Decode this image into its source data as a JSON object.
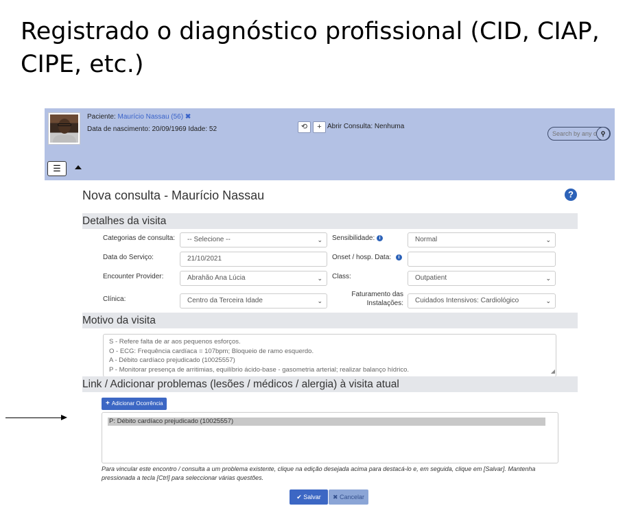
{
  "slide": {
    "title": "Registrado o diagnóstico profissional (CID, CIAP, CIPE, etc.)"
  },
  "patient_bar": {
    "patient_label": "Paciente:",
    "patient_name": "Maurício Nassau (56)",
    "close_glyph": "✖",
    "birth_info": "Data de nascimento: 20/09/1969 Idade: 52",
    "history_glyph": "⟲",
    "add_glyph": "+",
    "open_consult": "Abrir Consulta: Nenhuma",
    "search_placeholder": "Search by any de",
    "search_glyph": "🔍",
    "list_glyph": "☰"
  },
  "form": {
    "title": "Nova consulta - Maurício Nassau",
    "help_glyph": "?",
    "section_details": "Detalhes da visita",
    "categories_label": "Categorias de consulta:",
    "categories_value": "-- Selecione --",
    "sensitivity_label": "Sensibilidade:",
    "sensitivity_value": "Normal",
    "service_date_label": "Data do Serviço:",
    "service_date_value": "21/10/2021",
    "onset_label": "Onset / hosp. Data:",
    "onset_value": "",
    "provider_label": "Encounter Provider:",
    "provider_value": "Abrahão Ana Lúcia",
    "class_label": "Class:",
    "class_value": "Outpatient",
    "clinic_label": "Clínica:",
    "clinic_value": "Centro da Terceira Idade",
    "billing_label_1": "Faturamento das",
    "billing_label_2": "Instalações:",
    "billing_value": "Cuidados Intensivos: Cardiológico",
    "info_glyph": "i",
    "chevron_glyph": "⌄",
    "section_reason": "Motivo da visita",
    "reason_lines": [
      "S - Refere falta de ar aos pequenos esforços.",
      "O - ECG: Frequência cardíaca = 107bpm; Bloqueio de ramo esquerdo.",
      "A - Débito cardíaco prejudicado (10025557)",
      "P - Monitorar presença de arritimias, equilíbrio ácido-base - gasometria arterial; realizar balanço hídrico."
    ],
    "section_link": "Link / Adicionar problemas (lesões / médicos / alergia) à visita atual",
    "add_issue_label": "Adicionar Ocorrência",
    "add_issue_glyph": "+",
    "issues": [
      "P: Débito cardíaco prejudicado (10025557)"
    ],
    "help_text": "Para vincular este encontro / consulta a um problema existente, clique na edição desejada acima para destacá-lo e, em seguida, clique em [Salvar]. Mantenha pressionada a tecla [Ctrl] para seleccionar várias questões.",
    "save_label": "Salvar",
    "save_glyph": "✔",
    "cancel_label": "Cancelar",
    "cancel_glyph": "✖"
  }
}
